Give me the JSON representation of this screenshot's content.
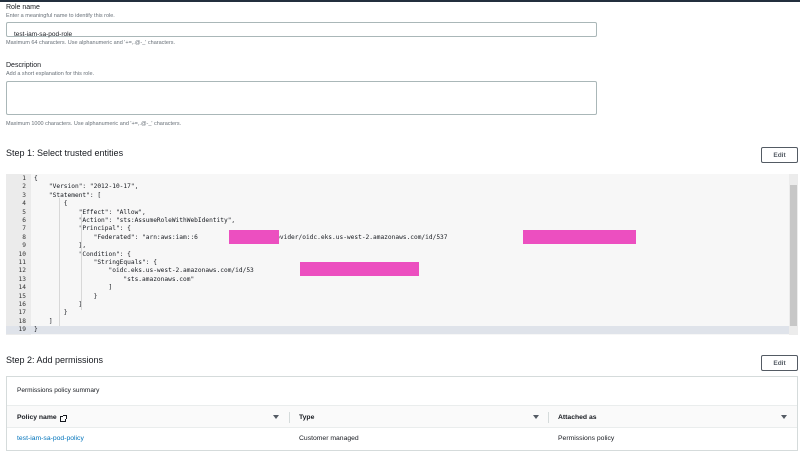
{
  "role_name": {
    "label": "Role name",
    "hint": "Enter a meaningful name to identify this role.",
    "value": "test-iam-sa-pod-role",
    "constraint": "Maximum 64 characters. Use alphanumeric and '+=,.@-_' characters."
  },
  "description": {
    "label": "Description",
    "hint": "Add a short explanation for this role.",
    "value": "",
    "constraint": "Maximum 1000 characters. Use alphanumeric and '+=,.@-_' characters."
  },
  "step1": {
    "title": "Step 1: Select trusted entities",
    "edit_label": "Edit",
    "lines": [
      {
        "n": "1",
        "text": "{"
      },
      {
        "n": "2",
        "text": "    \"Version\": \"2012-10-17\","
      },
      {
        "n": "3",
        "text": "    \"Statement\": ["
      },
      {
        "n": "4",
        "text": "        {"
      },
      {
        "n": "5",
        "text": "            \"Effect\": \"Allow\","
      },
      {
        "n": "6",
        "text": "            \"Action\": \"sts:AssumeRoleWithWebIdentity\","
      },
      {
        "n": "7",
        "text": "            \"Principal\": {"
      },
      {
        "n": "8",
        "text": "                \"Federated\": \"arn:aws:iam::6            2:oidc-provider/oidc.eks.us-west-2.amazonaws.com/id/537                       DA10\""
      },
      {
        "n": "9",
        "text": "            },"
      },
      {
        "n": "10",
        "text": "            \"Condition\": {"
      },
      {
        "n": "11",
        "text": "                \"StringEquals\": {"
      },
      {
        "n": "12",
        "text": "                    \"oidc.eks.us-west-2.amazonaws.com/id/53                      A10:aud\": ["
      },
      {
        "n": "13",
        "text": "                        \"sts.amazonaws.com\""
      },
      {
        "n": "14",
        "text": "                    ]"
      },
      {
        "n": "15",
        "text": "                }"
      },
      {
        "n": "16",
        "text": "            }"
      },
      {
        "n": "17",
        "text": "        }"
      },
      {
        "n": "18",
        "text": "    ]"
      },
      {
        "n": "19",
        "text": "}"
      }
    ]
  },
  "step2": {
    "title": "Step 2: Add permissions",
    "edit_label": "Edit",
    "panel_title": "Permissions policy summary",
    "columns": [
      "Policy name",
      "Type",
      "Attached as"
    ],
    "rows": [
      {
        "policy": "test-iam-sa-pod-policy",
        "type": "Customer managed",
        "attached": "Permissions policy"
      }
    ]
  },
  "colors": {
    "link": "#0073bb",
    "redaction": "#ec4fc0",
    "topbar": "#232f3e"
  }
}
